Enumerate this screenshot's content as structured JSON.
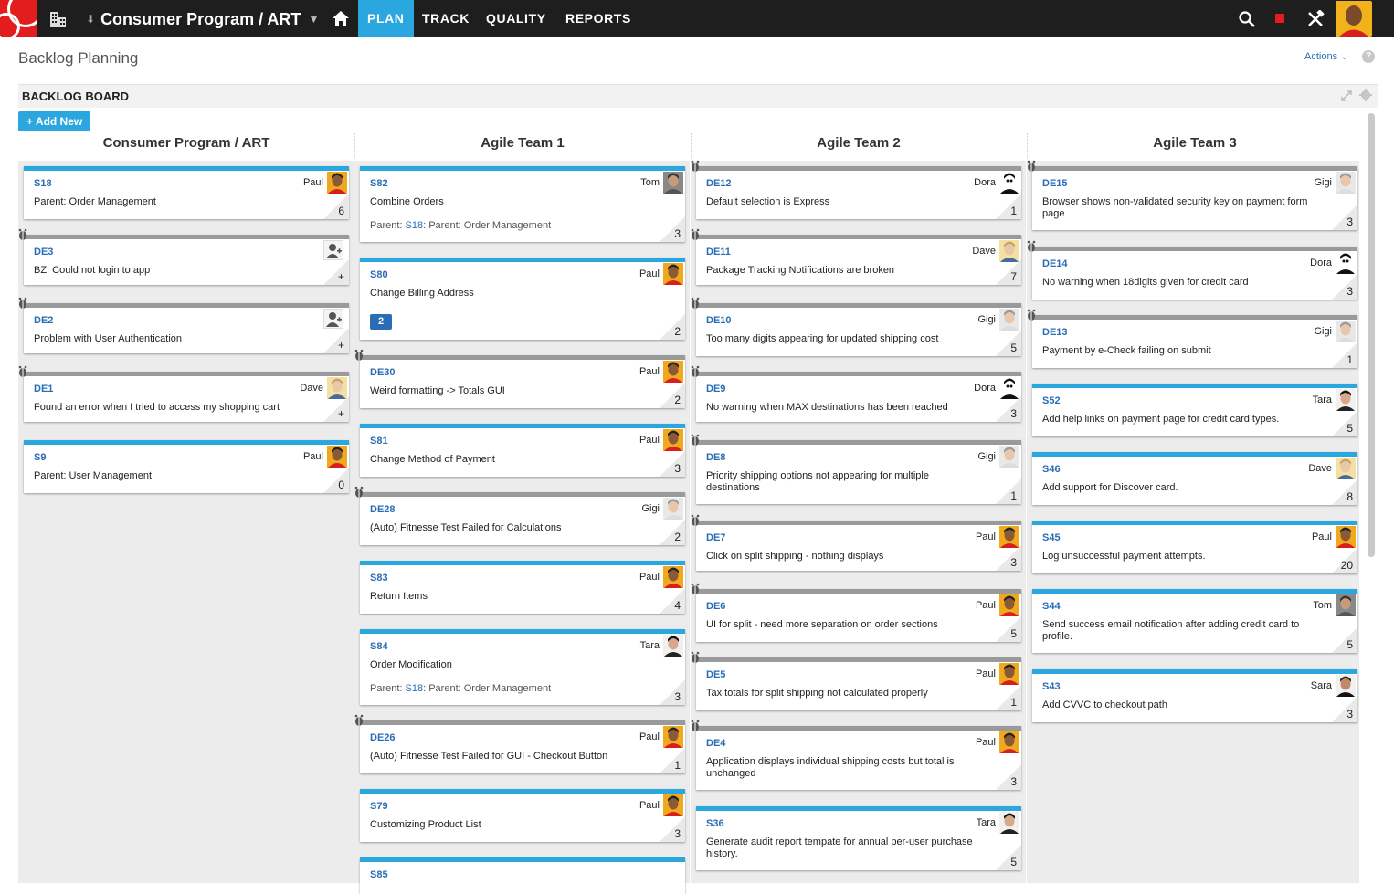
{
  "topbar": {
    "project": "Consumer Program / ART",
    "nav": [
      "PLAN",
      "TRACK",
      "QUALITY",
      "REPORTS"
    ]
  },
  "page": {
    "title": "Backlog Planning",
    "actions_label": "Actions",
    "help_label": "?",
    "board_title": "BACKLOG BOARD",
    "add_new_label": "+ Add New"
  },
  "columns": [
    {
      "title": "Consumer Program / ART",
      "cards": [
        {
          "type": "story",
          "id": "S18",
          "owner": "Paul",
          "title": "Parent: Order Management",
          "est": "6"
        },
        {
          "type": "defect",
          "id": "DE3",
          "owner": "",
          "title": "BZ: Could not login to app",
          "est": "+"
        },
        {
          "type": "defect",
          "id": "DE2",
          "owner": "",
          "title": "Problem with User Authentication",
          "est": "+"
        },
        {
          "type": "defect",
          "id": "DE1",
          "owner": "Dave",
          "title": "Found an error when I tried to access my shopping cart",
          "est": "+"
        },
        {
          "type": "story",
          "id": "S9",
          "owner": "Paul",
          "title": "Parent: User Management",
          "est": "0"
        }
      ]
    },
    {
      "title": "Agile Team 1",
      "cards": [
        {
          "type": "story",
          "id": "S82",
          "owner": "Tom",
          "title": "Combine Orders",
          "est": "3",
          "parent_label": "Parent:",
          "parent_link": "S18",
          "parent_text": ": Parent: Order Management"
        },
        {
          "type": "story",
          "id": "S80",
          "owner": "Paul",
          "title": "Change Billing Address",
          "est": "2",
          "comments": "2"
        },
        {
          "type": "defect",
          "id": "DE30",
          "owner": "Paul",
          "title": "Weird formatting -> Totals GUI",
          "est": "2"
        },
        {
          "type": "story",
          "id": "S81",
          "owner": "Paul",
          "title": "Change Method of Payment",
          "est": "3"
        },
        {
          "type": "defect",
          "id": "DE28",
          "owner": "Gigi",
          "title": "(Auto) Fitnesse Test Failed for Calculations",
          "est": "2"
        },
        {
          "type": "story",
          "id": "S83",
          "owner": "Paul",
          "title": "Return Items",
          "est": "4"
        },
        {
          "type": "story",
          "id": "S84",
          "owner": "Tara",
          "title": "Order Modification",
          "est": "3",
          "parent_label": "Parent:",
          "parent_link": "S18",
          "parent_text": ": Parent: Order Management"
        },
        {
          "type": "defect",
          "id": "DE26",
          "owner": "Paul",
          "title": "(Auto) Fitnesse Test Failed for GUI - Checkout Button",
          "est": "1"
        },
        {
          "type": "story",
          "id": "S79",
          "owner": "Paul",
          "title": "Customizing Product List",
          "est": "3"
        },
        {
          "type": "story",
          "id": "S85",
          "owner": "",
          "title": "",
          "est": ""
        }
      ]
    },
    {
      "title": "Agile Team 2",
      "cards": [
        {
          "type": "defect",
          "id": "DE12",
          "owner": "Dora",
          "title": "Default selection is Express",
          "est": "1"
        },
        {
          "type": "defect",
          "id": "DE11",
          "owner": "Dave",
          "title": "Package Tracking Notifications are broken",
          "est": "7"
        },
        {
          "type": "defect",
          "id": "DE10",
          "owner": "Gigi",
          "title": "Too many digits appearing for updated shipping cost",
          "est": "5"
        },
        {
          "type": "defect",
          "id": "DE9",
          "owner": "Dora",
          "title": "No warning when MAX destinations has been reached",
          "est": "3"
        },
        {
          "type": "defect",
          "id": "DE8",
          "owner": "Gigi",
          "title": "Priority shipping options not appearing for multiple destinations",
          "est": "1"
        },
        {
          "type": "defect",
          "id": "DE7",
          "owner": "Paul",
          "title": "Click on split shipping - nothing displays",
          "est": "3"
        },
        {
          "type": "defect",
          "id": "DE6",
          "owner": "Paul",
          "title": "UI for split - need more separation on order sections",
          "est": "5"
        },
        {
          "type": "defect",
          "id": "DE5",
          "owner": "Paul",
          "title": "Tax totals for split shipping not calculated properly",
          "est": "1"
        },
        {
          "type": "defect",
          "id": "DE4",
          "owner": "Paul",
          "title": "Application displays individual shipping costs but total is unchanged",
          "est": "3"
        },
        {
          "type": "story",
          "id": "S36",
          "owner": "Tara",
          "title": "Generate audit report tempate for annual per-user purchase history.",
          "est": "5"
        }
      ]
    },
    {
      "title": "Agile Team 3",
      "cards": [
        {
          "type": "defect",
          "id": "DE15",
          "owner": "Gigi",
          "title": "Browser shows non-validated security key on payment form page",
          "est": "3"
        },
        {
          "type": "defect",
          "id": "DE14",
          "owner": "Dora",
          "title": "No warning when 18digits given for credit card",
          "est": "3"
        },
        {
          "type": "defect",
          "id": "DE13",
          "owner": "Gigi",
          "title": "Payment by e-Check failing on submit",
          "est": "1"
        },
        {
          "type": "story",
          "id": "S52",
          "owner": "Tara",
          "title": "Add help links on payment page for credit card types.",
          "est": "5"
        },
        {
          "type": "story",
          "id": "S46",
          "owner": "Dave",
          "title": "Add support for Discover card.",
          "est": "8"
        },
        {
          "type": "story",
          "id": "S45",
          "owner": "Paul",
          "title": "Log unsuccessful payment attempts.",
          "est": "20"
        },
        {
          "type": "story",
          "id": "S44",
          "owner": "Tom",
          "title": "Send success email notification after adding credit card to profile.",
          "est": "5"
        },
        {
          "type": "story",
          "id": "S43",
          "owner": "Sara",
          "title": "Add CVVC to checkout path",
          "est": "3"
        }
      ]
    }
  ],
  "colors": {
    "story": "#2ba7df",
    "defect": "#9a9a9a",
    "link": "#2a6db5",
    "brand": "#e31d1d",
    "topbar": "#1e1e1e"
  },
  "icons": [
    "logo",
    "workspace-icon",
    "pin-icon",
    "home-icon",
    "search-icon",
    "stop-icon",
    "tools-icon",
    "user-avatar",
    "chevron-down-icon",
    "help-icon",
    "expand-icon",
    "gear-icon",
    "bug-icon",
    "assign-user-icon",
    "comment-icon"
  ]
}
